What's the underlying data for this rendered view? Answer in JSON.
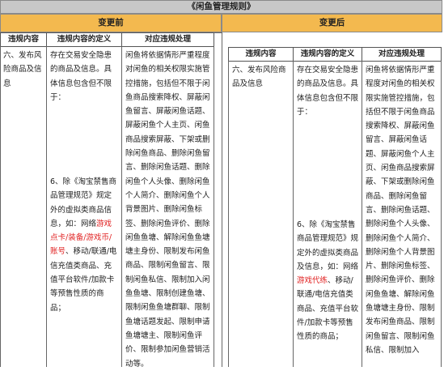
{
  "document": {
    "title": "《闲鱼管理规则》"
  },
  "before": {
    "header": "变更前",
    "columns": [
      "违规内容",
      "违规内容的定义",
      "对应违规处理"
    ],
    "violation": "六、发布风险商品及信息",
    "definition_p1": "存在交易安全隐患的商品及信息。具体信息包含但不限于：",
    "definition_p2_pre": "6、除《淘宝禁售商品管理规范》规定外的虚拟类商品信息，如：网络",
    "definition_p2_red1": "游戏点卡/装备/游戏币/账号",
    "definition_p2_mid": "、移动/联通/电信充值类商品、充值平台软件/加款卡等预售性质的商品；",
    "handling": "闲鱼将依据情形严重程度对闲鱼的相关权限实施管控措施，包括但不限于闲鱼商品搜索降权、屏蔽闲鱼留言、屏蔽闲鱼话题、屏蔽闲鱼个人主页、闲鱼商品搜索屏蔽、下架或删除闲鱼商品、删除闲鱼留言、删除闲鱼话题、删除闲鱼个人头像、删除闲鱼个人简介、删除闲鱼个人背景图片、删除闲鱼标签、删除闲鱼评价、删除闲鱼鱼塘、解除闲鱼鱼塘塘主身份、限制发布闲鱼商品、限制闲鱼留言、限制闲鱼私信、限制加入闲鱼鱼塘、限制创建鱼塘、限制闲鱼鱼塘群聊、限制鱼塘话题发起、限制申请鱼塘塘主、限制闲鱼评价、限制参加闲鱼营销活动等。"
  },
  "after": {
    "header": "变更后",
    "columns": [
      "违规内容",
      "违规内容的定义",
      "对应违规处理"
    ],
    "violation": "六、发布风险商品及信息",
    "definition_p1": "存在交易安全隐患的商品及信息。具体信息包含但不限于：",
    "definition_p2_pre": "6、除《淘宝禁售商品管理规范》规定外的虚拟类商品及信息，如：网络",
    "definition_p2_red1": "游戏代练",
    "definition_p2_mid": "、移动/联通/电信充值类商品、充值平台软件/加款卡等预售性质的商品；",
    "handling": "闲鱼将依据情形严重程度对闲鱼的相关权限实施管控措施，包括但不限于闲鱼商品搜索降权、屏蔽闲鱼留言、屏蔽闲鱼话题、屏蔽闲鱼个人主页、闲鱼商品搜索屏蔽、下架或删除闲鱼商品、删除闲鱼留言、删除闲鱼话题、删除闲鱼个人头像、删除闲鱼个人简介、删除闲鱼个人背景图片、删除闲鱼标签、删除闲鱼评价、删除闲鱼鱼塘、解除闲鱼鱼塘塘主身份、限制发布闲鱼商品、限制闲鱼留言、限制闲鱼私信、限制加入"
  },
  "colors": {
    "title_bg": "#c8c8c8",
    "header_bg": "#f3b94f",
    "highlight": "#e02020"
  }
}
